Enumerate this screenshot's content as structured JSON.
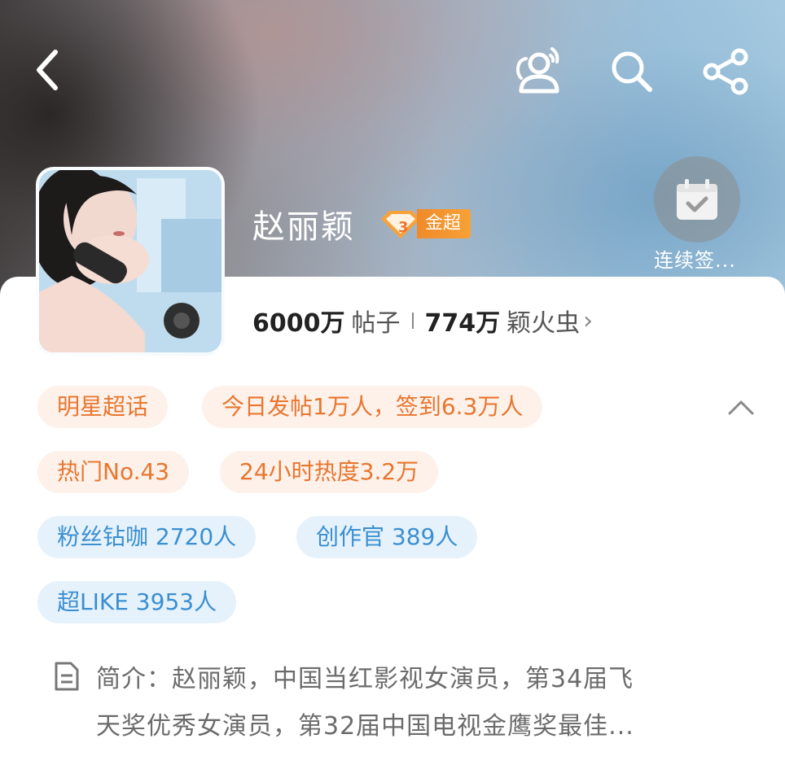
{
  "header": {
    "back_icon": "chevron-left-icon",
    "actions": [
      {
        "name": "people-icon"
      },
      {
        "name": "search-icon"
      },
      {
        "name": "share-icon"
      }
    ]
  },
  "profile": {
    "name": "赵丽颖",
    "level_badge": "金超",
    "checkin_label": "连续签...",
    "stats": {
      "posts_value": "6000万",
      "posts_label": "帖子",
      "fans_value": "774万",
      "fans_label": "颖火虫",
      "chevron": "›"
    }
  },
  "tags": {
    "row1": [
      "明星超话",
      "今日发帖1万人，签到6.3万人"
    ],
    "row2": [
      "热门No.43",
      "24小时热度3.2万"
    ],
    "row3": [
      "粉丝钻咖 2720人",
      "创作官 389人"
    ],
    "row4": [
      "超LIKE 3953人"
    ]
  },
  "intro": {
    "line1": "简介：赵丽颖，中国当红影视女演员，第34届飞",
    "line2": "天奖优秀女演员，第32届中国电视金鹰奖最佳..."
  },
  "colors": {
    "tag_orange_bg": "#fdf1ea",
    "tag_orange_text": "#e8762e",
    "tag_blue_bg": "#e6f2fb",
    "tag_blue_text": "#3a8fd2",
    "badge": "#f08a2a"
  }
}
